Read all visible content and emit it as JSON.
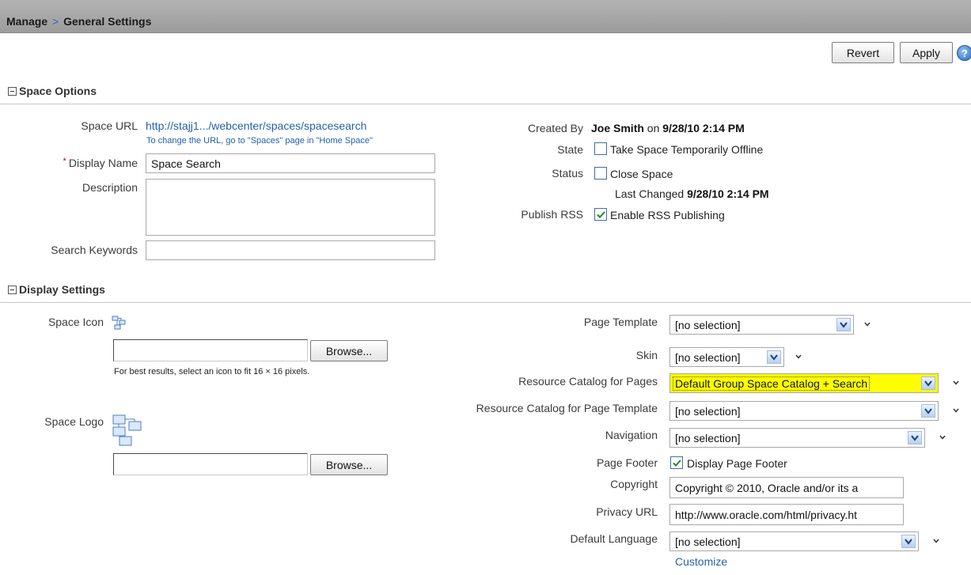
{
  "header": {
    "breadcrumb_parent": "Manage",
    "separator": ">",
    "breadcrumb_current": "General Settings"
  },
  "toolbar": {
    "revert_label": "Revert",
    "apply_label": "Apply",
    "help_glyph": "?"
  },
  "space_options": {
    "section_title": "Space Options",
    "space_url_label": "Space URL",
    "space_url_value": "http://stajj1.../webcenter/spaces/spacesearch",
    "space_url_hint": "To change the URL, go to \"Spaces\" page in \"Home Space\"",
    "display_name_label": "Display Name",
    "display_name_value": "Space Search",
    "description_label": "Description",
    "description_value": "",
    "search_keywords_label": "Search Keywords",
    "search_keywords_value": "",
    "created_by_label": "Created By",
    "created_by_value": "Joe Smith",
    "created_on_text": "on",
    "created_at": "9/28/10 2:14 PM",
    "state_label": "State",
    "state_checkbox_label": "Take Space Temporarily Offline",
    "state_checked": false,
    "status_label": "Status",
    "status_checkbox_label": "Close Space",
    "status_checked": false,
    "last_changed_label": "Last Changed",
    "last_changed_value": "9/28/10 2:14 PM",
    "publish_rss_label": "Publish RSS",
    "publish_rss_checkbox_label": "Enable RSS Publishing",
    "publish_rss_checked": true
  },
  "display_settings": {
    "section_title": "Display Settings",
    "space_icon_label": "Space Icon",
    "space_icon_value": "",
    "browse_label": "Browse...",
    "icon_hint": "For best results, select an icon to fit 16 × 16 pixels.",
    "space_logo_label": "Space Logo",
    "space_logo_value": "",
    "page_template_label": "Page Template",
    "page_template_value": "[no selection]",
    "skin_label": "Skin",
    "skin_value": "[no selection]",
    "resource_catalog_pages_label": "Resource Catalog for Pages",
    "resource_catalog_pages_value": "Default Group Space Catalog + Search",
    "resource_catalog_template_label": "Resource Catalog for Page Template",
    "resource_catalog_template_value": "[no selection]",
    "navigation_label": "Navigation",
    "navigation_value": "[no selection]",
    "page_footer_label": "Page Footer",
    "page_footer_checkbox_label": "Display Page Footer",
    "page_footer_checked": true,
    "copyright_label": "Copyright",
    "copyright_value": "Copyright © 2010, Oracle and/or its a",
    "privacy_url_label": "Privacy URL",
    "privacy_url_value": "http://www.oracle.com/html/privacy.ht",
    "default_language_label": "Default Language",
    "default_language_value": "[no selection]",
    "customize_label": "Customize"
  },
  "colors": {
    "header_bg": "#a8a8a8",
    "link": "#2561a8",
    "highlight": "#ffff00"
  }
}
